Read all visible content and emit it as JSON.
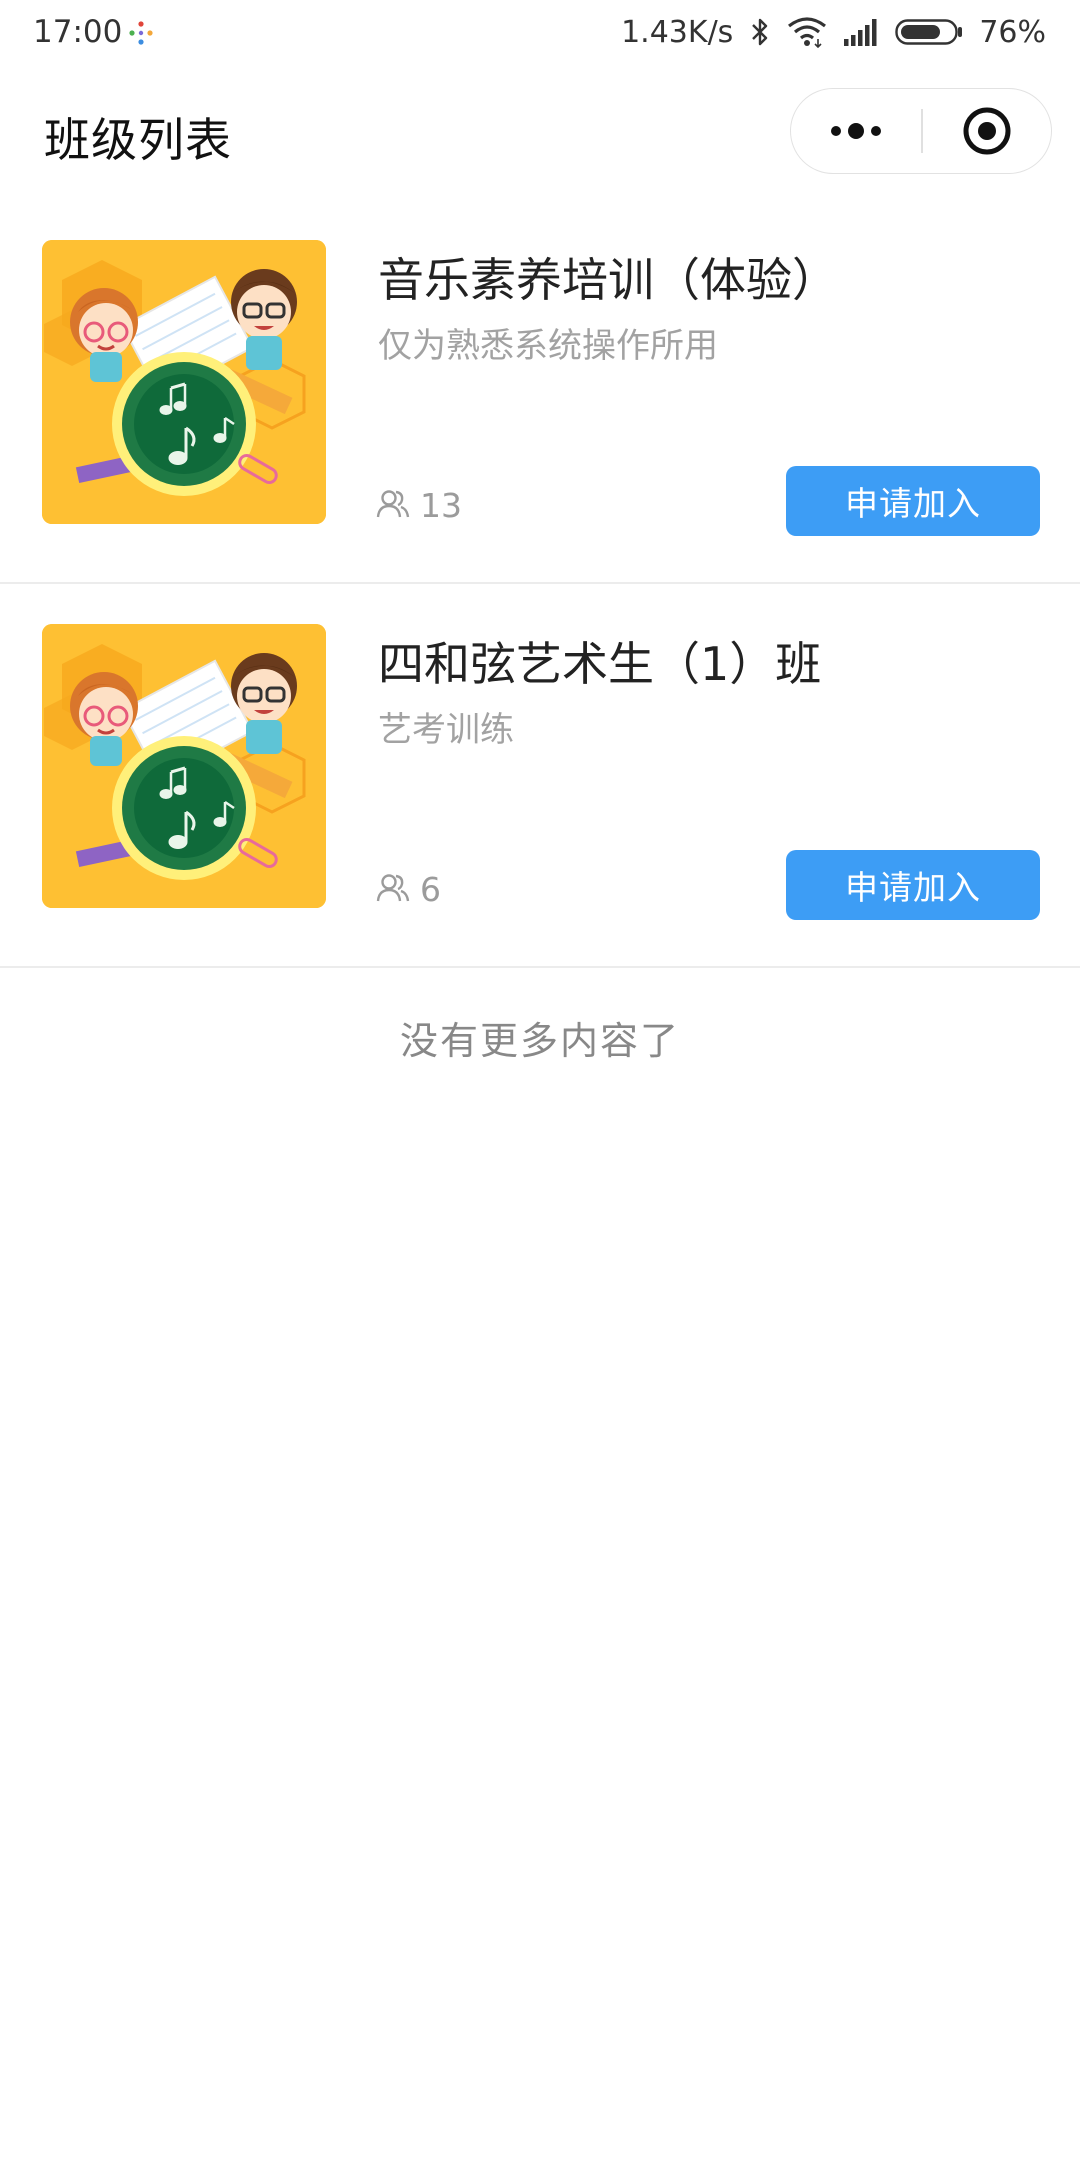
{
  "status_bar": {
    "time": "17:00",
    "network_speed": "1.43K/s",
    "battery_percent": "76%",
    "battery_level": 0.76,
    "icons": [
      "app-dots-icon",
      "bluetooth-icon",
      "wifi-icon",
      "signal-icon",
      "battery-icon"
    ]
  },
  "nav": {
    "title": "班级列表",
    "more_icon": "more-dots-icon",
    "close_icon": "target-close-icon"
  },
  "classes": [
    {
      "name": "音乐素养培训（体验）",
      "description": "仅为熟悉系统操作所用",
      "member_count": "13",
      "join_label": "申请加入",
      "cover_icon": "class-cover-illustration"
    },
    {
      "name": "四和弦艺术生（1）班",
      "description": "艺考训练",
      "member_count": "6",
      "join_label": "申请加入",
      "cover_icon": "class-cover-illustration"
    }
  ],
  "footer": {
    "no_more_text": "没有更多内容了"
  },
  "colors": {
    "accent": "#3d9df5",
    "cover_bg": "#fec033",
    "board": "#1f7a45"
  }
}
